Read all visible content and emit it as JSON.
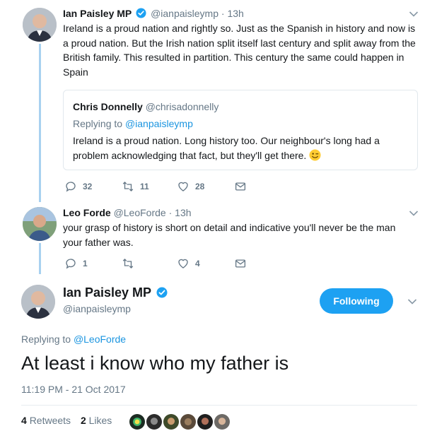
{
  "colors": {
    "accent": "#1da1f2",
    "link": "#1b95e0",
    "muted": "#657786",
    "thread": "#a8d1f0"
  },
  "tweet1": {
    "name": "Ian Paisley MP",
    "handle": "@ianpaisleymp",
    "dot": "·",
    "time": "13h",
    "text": "Ireland is a proud nation and rightly so. Just as the Spanish in history and now is a proud nation. But the Irish nation split itself last century and split away from the British family. This resulted in partition. This century the same could happen in Spain",
    "quote": {
      "name": "Chris Donnelly",
      "handle": "@chrisadonnelly",
      "replying_prefix": "Replying to",
      "replying_to": "@ianpaisleymp",
      "text": "Ireland is a proud nation. Long history too. Our neighbour's long had a problem acknowledging that fact, but they'll get there."
    },
    "actions": {
      "replies": "32",
      "retweets": "11",
      "likes": "28"
    }
  },
  "tweet2": {
    "name": "Leo Forde",
    "handle": "@LeoForde",
    "dot": "·",
    "time": "13h",
    "text": "your grasp of history is short on detail and indicative you'll never be the man your father was.",
    "actions": {
      "replies": "1",
      "retweets": "",
      "likes": "4"
    }
  },
  "main": {
    "name": "Ian Paisley MP",
    "handle": "@ianpaisleymp",
    "follow_label": "Following",
    "replying_prefix": "Replying to",
    "replying_to": "@LeoForde",
    "text": "At least i know who my father is",
    "timestamp": "11:19 PM - 21 Oct 2017",
    "retweets_count": "4",
    "retweets_label": "Retweets",
    "likes_count": "2",
    "likes_label": "Likes"
  }
}
